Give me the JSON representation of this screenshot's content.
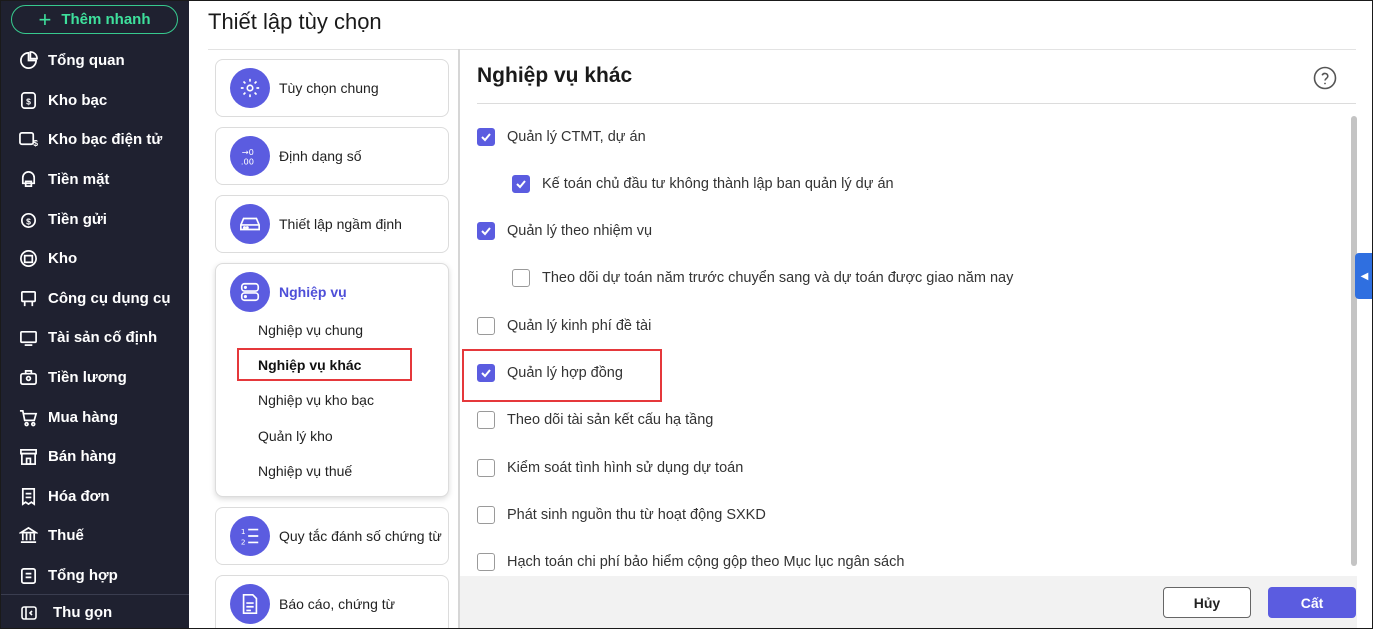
{
  "sidebar": {
    "quick_add": "Thêm nhanh",
    "items": [
      {
        "label": "Tổng quan",
        "icon": "pie-chart-icon"
      },
      {
        "label": "Kho bạc",
        "icon": "treasury-icon"
      },
      {
        "label": "Kho bạc điện tử",
        "icon": "e-treasury-icon"
      },
      {
        "label": "Tiền mặt",
        "icon": "cash-icon"
      },
      {
        "label": "Tiền gửi",
        "icon": "deposit-icon"
      },
      {
        "label": "Kho",
        "icon": "warehouse-icon"
      },
      {
        "label": "Công cụ dụng cụ",
        "icon": "tools-icon"
      },
      {
        "label": "Tài sản cố định",
        "icon": "fixed-asset-icon"
      },
      {
        "label": "Tiền lương",
        "icon": "salary-icon"
      },
      {
        "label": "Mua hàng",
        "icon": "cart-icon"
      },
      {
        "label": "Bán hàng",
        "icon": "store-icon"
      },
      {
        "label": "Hóa đơn",
        "icon": "invoice-icon"
      },
      {
        "label": "Thuế",
        "icon": "tax-icon"
      },
      {
        "label": "Tổng hợp",
        "icon": "summary-icon"
      }
    ],
    "collapse": "Thu gọn"
  },
  "page": {
    "title": "Thiết lập tùy chọn"
  },
  "categories": {
    "general": "Tùy chọn chung",
    "number_format": "Định dạng số",
    "default_setup": "Thiết lập ngầm định",
    "business": "Nghiệp vụ",
    "business_sub": [
      "Nghiệp vụ chung",
      "Nghiệp vụ khác",
      "Nghiệp vụ kho bạc",
      "Quản lý kho",
      "Nghiệp vụ thuế"
    ],
    "numbering": "Quy tắc đánh số chứng từ",
    "reports": "Báo cáo, chứng từ"
  },
  "section": {
    "title": "Nghiệp vụ khác",
    "options": [
      {
        "label": "Quản lý CTMT, dự án",
        "checked": true
      },
      {
        "label": "Kế toán chủ đầu tư không thành lập ban quản lý dự án",
        "checked": true
      },
      {
        "label": "Quản lý theo nhiệm vụ",
        "checked": true
      },
      {
        "label": "Theo dõi dự toán năm trước chuyển sang và dự toán được giao năm nay",
        "checked": false
      },
      {
        "label": "Quản lý kinh phí đề tài",
        "checked": false
      },
      {
        "label": "Quản lý hợp đồng",
        "checked": true
      },
      {
        "label": "Theo dõi tài sản kết cấu hạ tầng",
        "checked": false
      },
      {
        "label": "Kiểm soát tình hình sử dụng dự toán",
        "checked": false
      },
      {
        "label": "Phát sinh nguồn thu từ hoạt động SXKD",
        "checked": false
      },
      {
        "label": "Hạch toán chi phí bảo hiểm cộng gộp theo Mục lục ngân sách",
        "checked": false
      }
    ]
  },
  "footer": {
    "cancel": "Hủy",
    "save": "Cất"
  },
  "colors": {
    "accent": "#5b5ce0",
    "sidebar_bg": "#1f2130",
    "highlight": "#e5383b",
    "quick_add": "#3ee09c"
  }
}
